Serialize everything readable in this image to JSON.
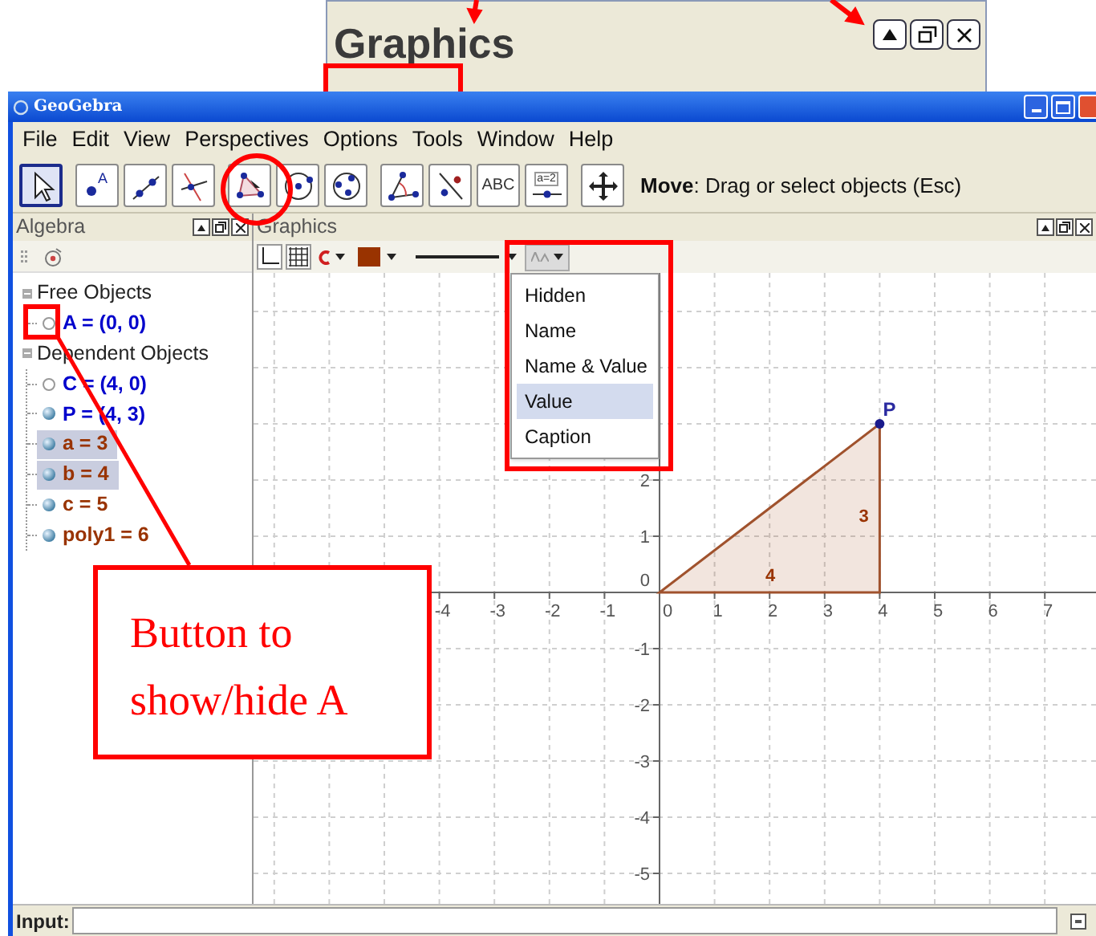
{
  "inset_panel": {
    "title": "Graphics"
  },
  "window": {
    "title": "GeoGebra"
  },
  "menu": [
    "File",
    "Edit",
    "View",
    "Perspectives",
    "Options",
    "Tools",
    "Window",
    "Help"
  ],
  "toolbar": {
    "groups": [
      [
        {
          "kind": "move",
          "selected": true
        }
      ],
      [
        {
          "kind": "point",
          "label": "A",
          "selected": false
        },
        {
          "kind": "line",
          "selected": false
        },
        {
          "kind": "perpendicular",
          "selected": false
        }
      ],
      [
        {
          "kind": "polygon",
          "selected": false
        },
        {
          "kind": "circle",
          "selected": false
        },
        {
          "kind": "circle3",
          "selected": false
        }
      ],
      [
        {
          "kind": "angle",
          "selected": false
        },
        {
          "kind": "reflect",
          "selected": false
        },
        {
          "kind": "text",
          "label": "ABC",
          "selected": false
        },
        {
          "kind": "slider",
          "label": "a=2",
          "selected": false
        }
      ],
      [
        {
          "kind": "move_view",
          "selected": false
        }
      ]
    ],
    "hint": "**Move**: Drag or select objects (Esc)"
  },
  "algebra": {
    "title": "Algebra",
    "tree": [
      {
        "label": "Free Objects",
        "expanded": true,
        "children": [
          {
            "label": "A = (0, 0)",
            "visible": false,
            "selected": false,
            "color": "#0000cc"
          }
        ]
      },
      {
        "label": "Dependent Objects",
        "expanded": true,
        "children": [
          {
            "label": "C = (4, 0)",
            "visible": false,
            "selected": false,
            "color": "#0000cc"
          },
          {
            "label": "P = (4, 3)",
            "visible": true,
            "selected": false,
            "color": "#0000cc"
          },
          {
            "label": "a = 3",
            "visible": true,
            "selected": true,
            "color": "#993300"
          },
          {
            "label": "b = 4",
            "visible": true,
            "selected": true,
            "color": "#993300"
          },
          {
            "label": "c = 5",
            "visible": true,
            "selected": false,
            "color": "#993300"
          },
          {
            "label": "poly1 = 6",
            "visible": true,
            "selected": false,
            "color": "#993300"
          }
        ]
      }
    ]
  },
  "graphics": {
    "title": "Graphics",
    "label_menu": {
      "open": true,
      "items": [
        {
          "label": "Hidden",
          "selected": false
        },
        {
          "label": "Name",
          "selected": false
        },
        {
          "label": "Name & Value",
          "selected": false
        },
        {
          "label": "Value",
          "selected": true
        },
        {
          "label": "Caption",
          "selected": false
        }
      ]
    },
    "x_labels": [
      "-4",
      "-3",
      "-2",
      "-1",
      "0",
      "1",
      "2",
      "3",
      "4",
      "5",
      "6",
      "7"
    ],
    "y_labels": [
      "2",
      "1",
      "0",
      "-1",
      "-2",
      "-3",
      "-4",
      "-5"
    ],
    "point_label": "P",
    "vertical_side_label": "3",
    "horizontal_side_label": "4"
  },
  "input_bar": {
    "label": "Input:"
  },
  "callout": {
    "text": "Button to show/hide A"
  }
}
